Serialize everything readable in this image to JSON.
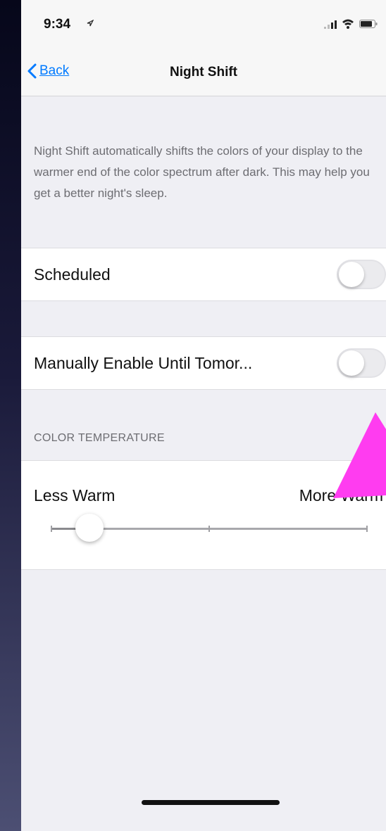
{
  "status_bar": {
    "time": "9:34",
    "icons": [
      "location-arrow-icon",
      "signal-icon",
      "wifi-icon",
      "battery-icon"
    ]
  },
  "nav": {
    "back_label": "Back",
    "title": "Night Shift"
  },
  "description": "Night Shift automatically shifts the colors of your display to the warmer end of the color spectrum after dark. This may help you get a better night's sleep.",
  "scheduled": {
    "label": "Scheduled",
    "enabled": false
  },
  "manual": {
    "label": "Manually Enable Until Tomor...",
    "enabled": false
  },
  "color_temperature": {
    "header": "COLOR TEMPERATURE",
    "min_label": "Less Warm",
    "max_label": "More Warm",
    "value": 0.12
  },
  "annotation": {
    "color": "#ff3cf0"
  }
}
